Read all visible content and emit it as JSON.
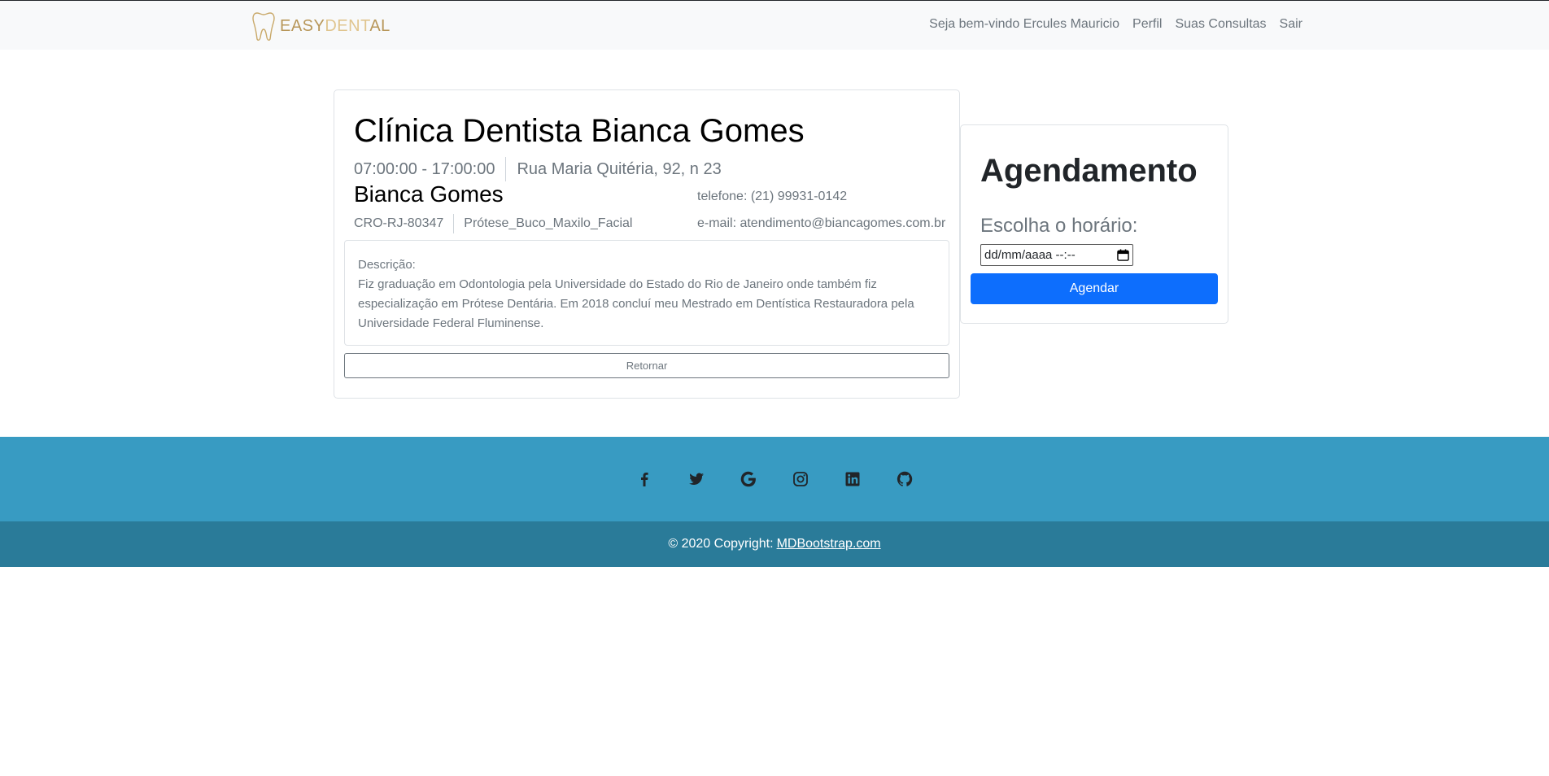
{
  "brand": {
    "logo_part1": "EASY",
    "logo_part2": "DENT",
    "logo_part3": "AL",
    "logo_icon": "tooth-icon"
  },
  "nav": {
    "welcome": "Seja bem-vindo Ercules Mauricio",
    "profile": "Perfil",
    "appointments": "Suas Consultas",
    "logout": "Sair"
  },
  "clinic": {
    "title": "Clínica Dentista Bianca Gomes",
    "hours": "07:00:00 - 17:00:00",
    "address": "Rua Maria Quitéria, 92, n 23",
    "doctor_name": "Bianca Gomes",
    "cro": "CRO-RJ-80347",
    "specialty": "Prótese_Buco_Maxilo_Facial",
    "phone": "telefone: (21) 99931-0142",
    "email": "e-mail: atendimento@biancagomes.com.br",
    "description_label": "Descrição:",
    "description": "Fiz graduação em Odontologia pela Universidade do Estado do Rio de Janeiro onde também fiz especialização em Prótese Dentária. Em 2018 concluí meu Mestrado em Dentística Restauradora pela Universidade Federal Fluminense.",
    "return_label": "Retornar"
  },
  "scheduling": {
    "title": "Agendamento",
    "label": "Escolha o horário:",
    "datetime_value": "dd/mm/aaaa --:--",
    "button_label": "Agendar"
  },
  "footer": {
    "social_icons": [
      "facebook-icon",
      "twitter-icon",
      "google-icon",
      "instagram-icon",
      "linkedin-icon",
      "github-icon"
    ],
    "copyright": "© 2020 Copyright:",
    "link": "MDBootstrap.com"
  },
  "colors": {
    "primary": "#0d6efd",
    "footer_top": "#389bc2",
    "footer_bottom": "#2a7b99",
    "brand_gold": "#b8975a"
  }
}
